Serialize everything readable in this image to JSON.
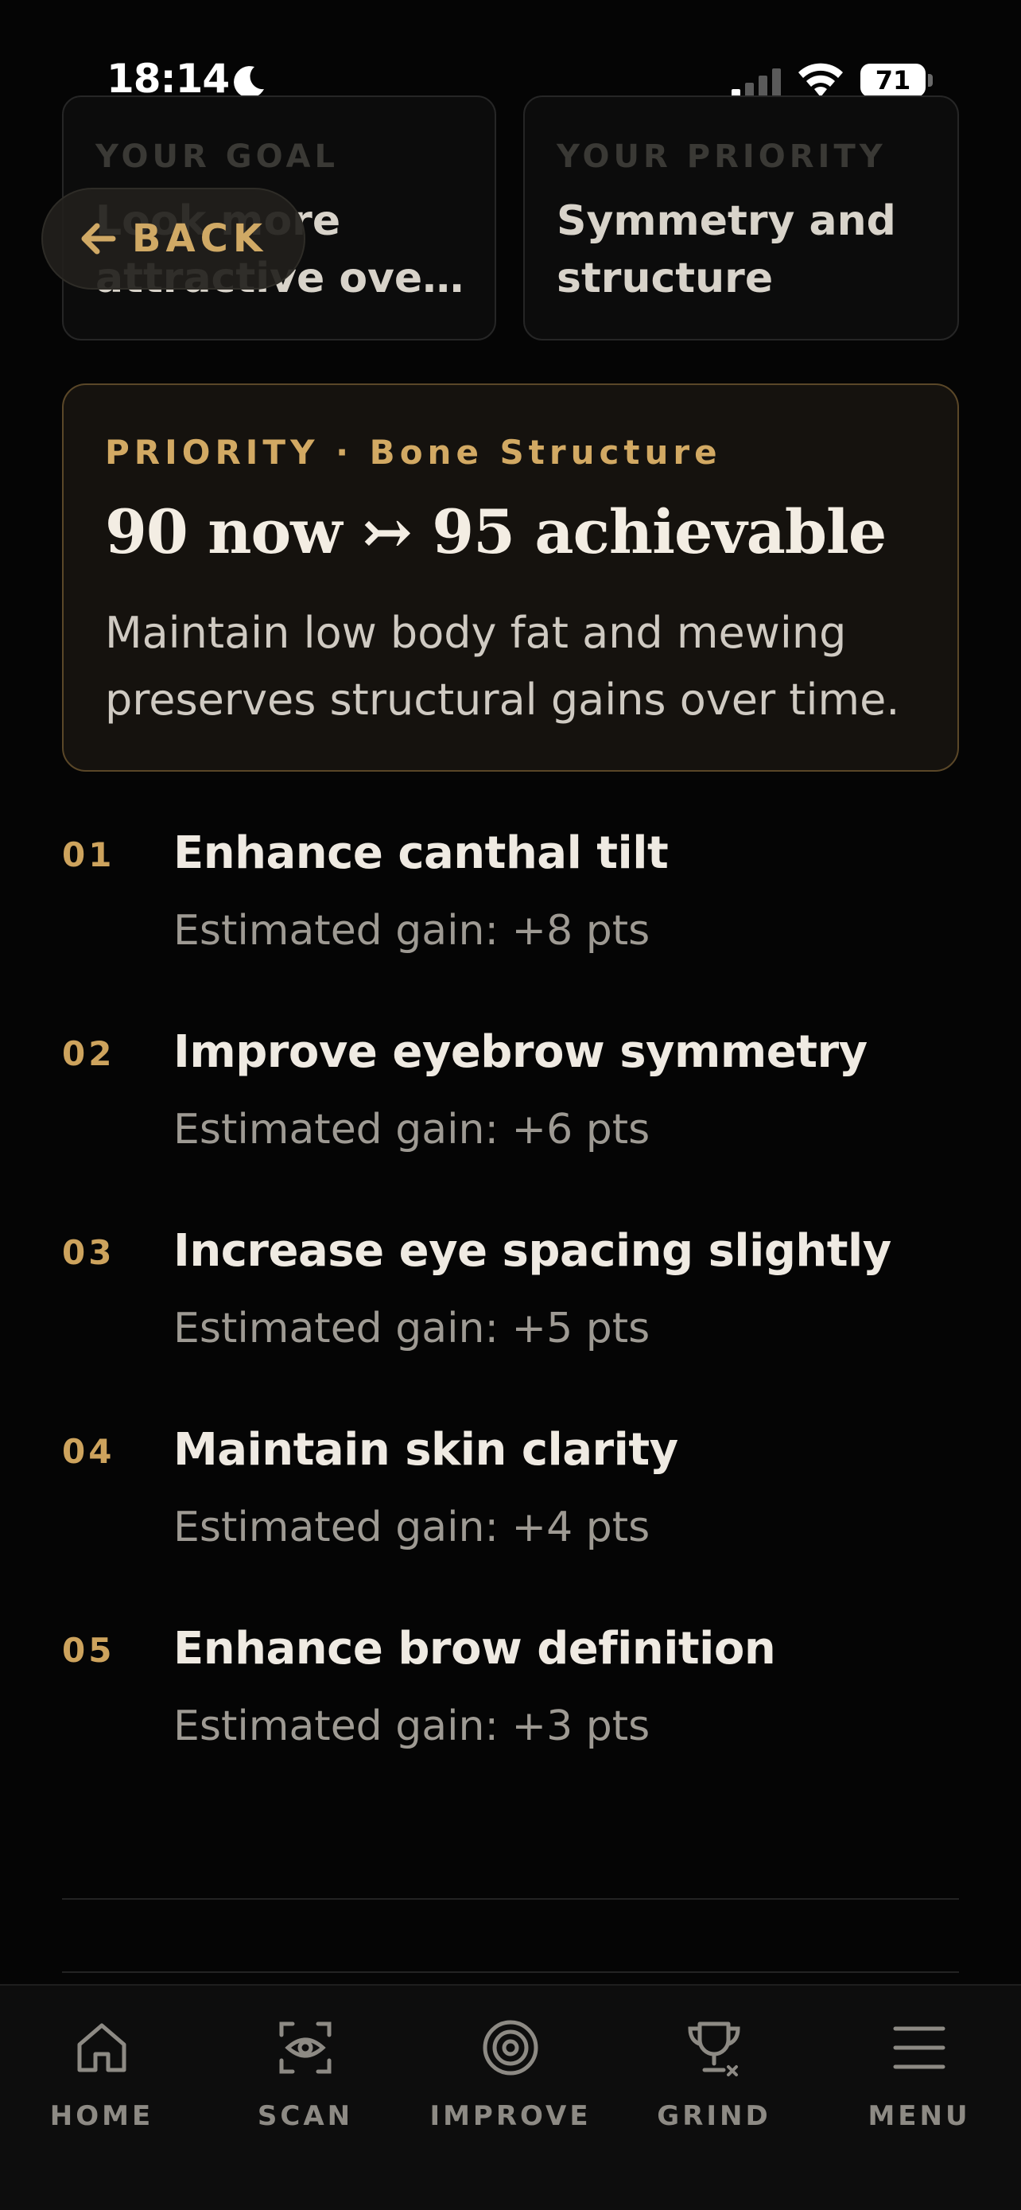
{
  "status_bar": {
    "time": "18:14",
    "battery": "71"
  },
  "goal": {
    "label": "YOUR GOAL",
    "value_line1": "Look more",
    "value_line2": "attractive ove..."
  },
  "priority_focus": {
    "label": "YOUR PRIORITY",
    "value": "Symmetry and structure"
  },
  "back_button": {
    "label": "BACK"
  },
  "priority_card": {
    "eyebrow": "PRIORITY · Bone Structure",
    "headline": "90 now ↣ 95 achievable",
    "description": "Maintain low body fat and mewing preserves structural gains over time."
  },
  "improvements": [
    {
      "number": "01",
      "title": "Enhance canthal tilt",
      "gain": "Estimated gain: +8 pts"
    },
    {
      "number": "02",
      "title": "Improve eyebrow symmetry",
      "gain": "Estimated gain: +6 pts"
    },
    {
      "number": "03",
      "title": "Increase eye spacing slightly",
      "gain": "Estimated gain: +5 pts"
    },
    {
      "number": "04",
      "title": "Maintain skin clarity",
      "gain": "Estimated gain: +4 pts"
    },
    {
      "number": "05",
      "title": "Enhance brow definition",
      "gain": "Estimated gain: +3 pts"
    }
  ],
  "tab_bar": {
    "tabs": [
      {
        "label": "HOME",
        "icon": "home-icon"
      },
      {
        "label": "SCAN",
        "icon": "scan-icon"
      },
      {
        "label": "IMPROVE",
        "icon": "target-icon"
      },
      {
        "label": "GRIND",
        "icon": "trophy-icon"
      },
      {
        "label": "MENU",
        "icon": "menu-icon"
      }
    ]
  },
  "colors": {
    "background": "#050505",
    "accent_gold": "#d2a963",
    "card_border_gold": "#5a4728",
    "muted_text": "#9e9a93"
  }
}
